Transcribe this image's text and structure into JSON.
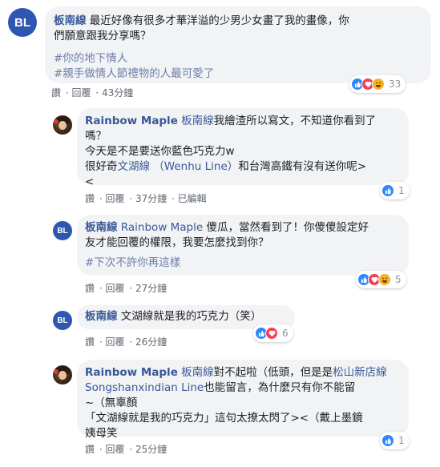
{
  "comments": [
    {
      "avatar": "BL",
      "author": "板南線",
      "lines": [
        "最近好像有很多才華洋溢的少男少女畫了我的畫像，你",
        "們願意跟我分享嗎？"
      ],
      "hashtags": [
        "#你的地下情人",
        "#親手做情人節禮物的人最可愛了"
      ],
      "actions": {
        "like": "讚",
        "reply": "回覆",
        "time": "43分鐘"
      },
      "reactions": {
        "icons": [
          "like-icon",
          "love-icon",
          "haha-icon"
        ],
        "count": "33"
      }
    },
    {
      "avatar": "",
      "author": "Rainbow Maple",
      "tag": "板南線",
      "line1_rest": "我繪渣所以寫文，不知道你看到了",
      "line2": "嗎？",
      "line3": "今天是不是要送你藍色巧克力w",
      "line4_pre": "很好奇",
      "line4_tag": "文湖線 （Wenhu Line）",
      "line4_post": "和台灣高鐵有沒有送你呢>",
      "line5": "<",
      "actions": {
        "like": "讚",
        "reply": "回覆",
        "time": "37分鐘",
        "edited": "已編輯"
      },
      "reactions": {
        "icons": [
          "like-icon"
        ],
        "count": "1"
      }
    },
    {
      "avatar": "BL",
      "author": "板南線",
      "tag": "Rainbow Maple",
      "line1_rest": "傻瓜，當然看到了！你傻傻設定好",
      "line2": "友才能回覆的權限，我要怎麼找到你？",
      "hashtag": "#下次不許你再這樣",
      "actions": {
        "like": "讚",
        "reply": "回覆",
        "time": "27分鐘"
      },
      "reactions": {
        "icons": [
          "like-icon",
          "love-icon",
          "haha-icon"
        ],
        "count": "5"
      }
    },
    {
      "avatar": "BL",
      "author": "板南線",
      "text": "文湖線就是我的巧克力（笑）",
      "actions": {
        "like": "讚",
        "reply": "回覆",
        "time": "26分鐘"
      },
      "reactions": {
        "icons": [
          "like-icon",
          "love-icon"
        ],
        "count": "6"
      }
    },
    {
      "avatar": "",
      "author": "Rainbow Maple",
      "tag": "板南線",
      "line1_rest": "對不起啦（低頭，但是是",
      "line1_tag": "松山新店線",
      "line2_tag": "Songshanxindian Line",
      "line2_rest": "也能留言，為什麼只有你不能留",
      "line3": "~（無辜顏",
      "line4": "「文湖線就是我的巧克力」這句太撩太閃了><（戴上墨鏡",
      "line5": "姨母笑",
      "actions": {
        "like": "讚",
        "reply": "回覆",
        "time": "25分鐘"
      },
      "reactions": {
        "icons": [
          "like-icon"
        ],
        "count": "1"
      }
    }
  ],
  "colors": {
    "link": "#385898",
    "bubble": "#f2f3f5",
    "like": "#2d88ff",
    "love": "#f33e58",
    "haha": "#f7b125"
  }
}
